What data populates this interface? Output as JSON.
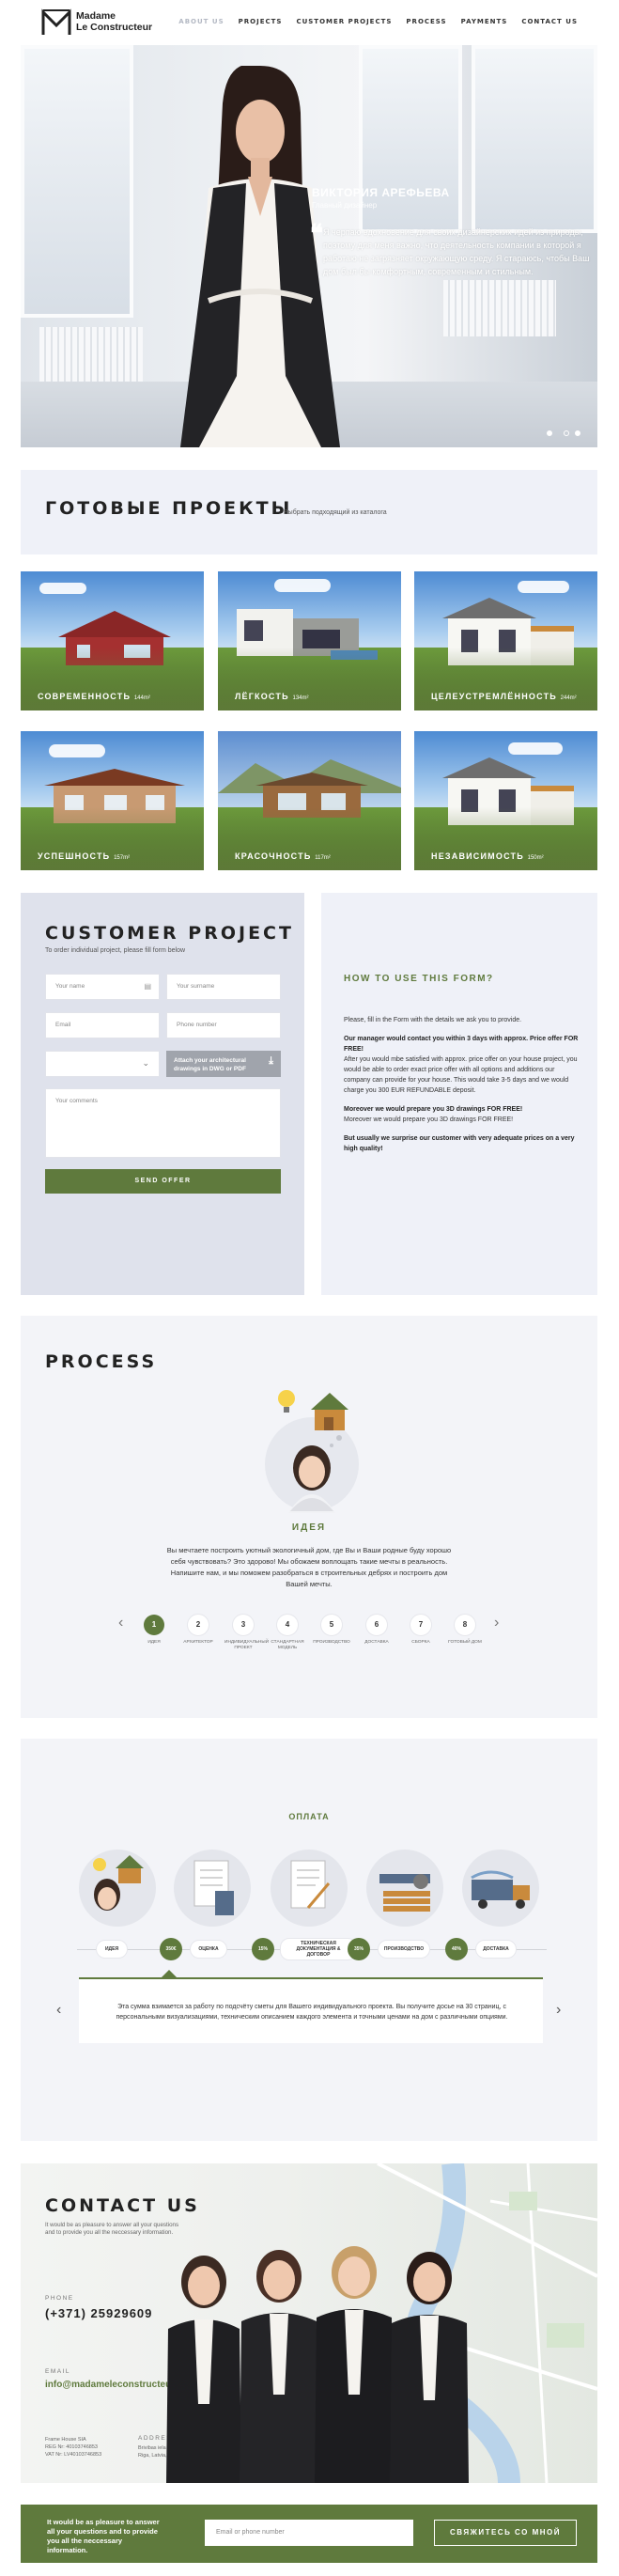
{
  "brand": {
    "line1": "Madame",
    "line2": "Le Constructeur",
    "accent": "#5f7a3d"
  },
  "nav": [
    {
      "label": "ABOUT US",
      "active": true
    },
    {
      "label": "PROJECTS"
    },
    {
      "label": "CUSTOMER PROJECTS"
    },
    {
      "label": "PROCESS"
    },
    {
      "label": "PAYMENTS"
    },
    {
      "label": "CONTACT US"
    }
  ],
  "hero": {
    "name": "ВИКТОРИЯ АРЕФЬЕВА",
    "role": "Главный дизайнер",
    "quote": "Я черпаю вдохновение для своих дизайнерских идей из природы, поэтому для меня важно, что деятельность компании в которой я работаю не загрязняет окружающую среду. Я стараюсь, чтобы Ваш дом был бы комфортным, современным и стильным."
  },
  "ready": {
    "title": "ГОТОВЫЕ ПРОЕКТЫ",
    "subtitle": "Выбрать подходящий из каталога",
    "tiles": [
      {
        "label": "СОВРЕМЕННОСТЬ",
        "area": "144m²"
      },
      {
        "label": "ЛЁГКОСТЬ",
        "area": "134m²"
      },
      {
        "label": "ЦЕЛЕУСТРЕМЛЁННОСТЬ",
        "area": "244m²"
      },
      {
        "label": "УСПЕШНОСТЬ",
        "area": "157m²"
      },
      {
        "label": "КРАСОЧНОСТЬ",
        "area": "117m²"
      },
      {
        "label": "НЕЗАВИСИМОСТЬ",
        "area": "150m²"
      }
    ]
  },
  "customer": {
    "title": "CUSTOMER PROJECT",
    "subtitle": "To order individual project, please fill form below",
    "fields": {
      "name": "Your name",
      "surname": "Your surname",
      "email": "Email",
      "phone": "Phone number",
      "comments": "Your comments"
    },
    "attach": "Attach your architectural drawings in DWG or PDF",
    "send": "SEND OFFER"
  },
  "how": {
    "title": "HOW TO USE THIS FORM?",
    "p1": "Please, fill in the Form with the details we ask you to provide.",
    "p2_bold": "Our manager would contact you within 3 days with approx. Price offer FOR FREE!",
    "p2": "After you would mbe satisfied with approx. price offer on your house project, you would be able to order exact price offer with all options and additions our company can provide for your house. This would take 3-5 days and we would charge you 300 EUR REFUNDABLE deposit.",
    "p3_bold": "Moreover we would prepare you 3D drawings FOR FREE!",
    "p3": "Moreover we would prepare you 3D drawings FOR FREE!",
    "p4_bold": "But usually we surprise our customer with very adequate prices on a very high quality!"
  },
  "process": {
    "title": "PROCESS",
    "step_title": "ИДЕЯ",
    "step_text": "Вы мечтаете построить уютный экологичный дом, где Вы и Ваши родные буду хорошо себя чувствовать? Это здорово! Мы обожаем воплощать такие мечты в реальность. Напишите нам, и мы поможем разобраться в строительных дебрях и построить дом Вашей мечты.",
    "steps": [
      {
        "n": "1",
        "label": "ИДЕЯ"
      },
      {
        "n": "2",
        "label": "АРХИТЕКТОР"
      },
      {
        "n": "3",
        "label": "ИНДИВИДУАЛЬНЫЙ ПРОЕКТ"
      },
      {
        "n": "4",
        "label": "СТАНДАРТНАЯ МОДЕЛЬ"
      },
      {
        "n": "5",
        "label": "ПРОИЗВОДСТВО"
      },
      {
        "n": "6",
        "label": "ДОСТАВКА"
      },
      {
        "n": "7",
        "label": "СБОРКА"
      },
      {
        "n": "8",
        "label": "ГОТОВЫЙ ДОМ"
      }
    ]
  },
  "payment": {
    "title": "ОПЛАТА",
    "nodes": [
      {
        "label": "ИДЕЯ"
      },
      {
        "label": "350€",
        "green": true
      },
      {
        "label": "ОЦЕНКА"
      },
      {
        "label": "15%",
        "green": true
      },
      {
        "label": "ТЕХНИЧЕСКАЯ ДОКУМЕНТАЦИЯ & ДОГОВОР"
      },
      {
        "label": "35%",
        "green": true
      },
      {
        "label": "ПРОИЗВОДСТВО"
      },
      {
        "label": "40%",
        "green": true
      },
      {
        "label": "ДОСТАВКА"
      }
    ],
    "text": "Эта сумма взимается за работу по подсчёту сметы для Вашего индивидуального проекта. Вы получите досье на 30 страниц, с персональными визуализациями, техническим описанием каждого элемента и точными ценами на дом с различными опциями."
  },
  "contact": {
    "title": "CONTACT US",
    "subtitle": "It would be as pleasure to answer all your questions and to provide you all the neccessary information.",
    "phone_label": "PHONE",
    "phone": "(+371) 25929609",
    "email_label": "EMAIL",
    "email": "info@madameleconstructeur.lv",
    "company": "Frame House SIA",
    "reg": "REG Nr: 40103746853",
    "vat": "VAT Nr: LV40103746853",
    "address_label": "ADDRESS",
    "address1": "Brivibas iela 147",
    "address2": "Riga, Latvia, LV-1048"
  },
  "footer": {
    "message": "It would be as pleasure to answer all your questions and to provide you all the neccessary information.",
    "placeholder": "Email or phone number",
    "button": "СВЯЖИТЕСЬ СО МНОЙ"
  }
}
